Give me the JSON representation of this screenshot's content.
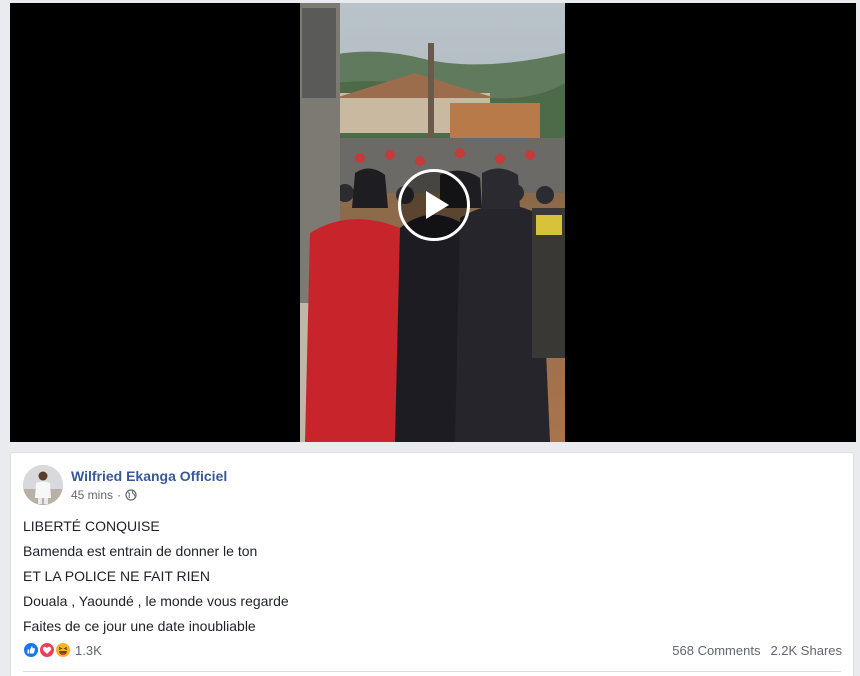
{
  "video": {
    "play_icon": "play-icon"
  },
  "post": {
    "author": "Wilfried Ekanga Officiel",
    "time": "45 mins",
    "separator": "·",
    "privacy_icon": "globe-icon",
    "lines": [
      "LIBERTÉ CONQUISE",
      "Bamenda est entrain de donner le ton",
      "ET LA POLICE NE FAIT RIEN",
      "Douala , Yaoundé , le monde vous regarde",
      "Faites de ce jour une date inoubliable"
    ],
    "reactions": {
      "icons": [
        "like-icon",
        "love-icon",
        "haha-icon"
      ],
      "count": "1.3K"
    },
    "comments": "568 Comments",
    "shares": "2.2K Shares"
  },
  "colors": {
    "link": "#385898",
    "like": "#1877f2",
    "love": "#f33e58",
    "haha": "#f7b125"
  }
}
